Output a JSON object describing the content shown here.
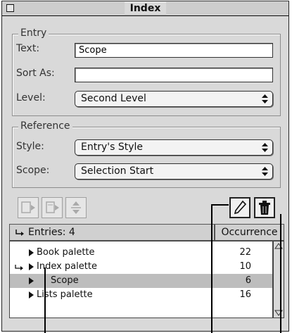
{
  "window": {
    "title": "Index"
  },
  "entry": {
    "group_label": "Entry",
    "text_label": "Text:",
    "text_value": "Scope",
    "sort_as_label": "Sort As:",
    "sort_as_value": "",
    "level_label": "Level:",
    "level_value": "Second Level"
  },
  "reference": {
    "group_label": "Reference",
    "style_label": "Style:",
    "style_value": "Entry's Style",
    "scope_label": "Scope:",
    "scope_value": "Selection Start"
  },
  "toolbar": {
    "buttons": [
      "add-entry-icon",
      "add-reference-icon",
      "find-icon",
      "edit-pencil-icon",
      "trash-icon"
    ]
  },
  "list": {
    "entries_header": "Entries: 4",
    "occurrence_header": "Occurrence",
    "rows": [
      {
        "name": "Book palette",
        "count": "22",
        "selected": false,
        "marked": false
      },
      {
        "name": "Index palette",
        "count": "10",
        "selected": false,
        "marked": true
      },
      {
        "name": "Scope",
        "count": "6",
        "selected": true,
        "marked": false
      },
      {
        "name": "Lists palette",
        "count": "16",
        "selected": false,
        "marked": false
      }
    ]
  },
  "colors": {
    "window_bg": "#d9d9d9",
    "selection_bg": "#bdbdbd"
  }
}
